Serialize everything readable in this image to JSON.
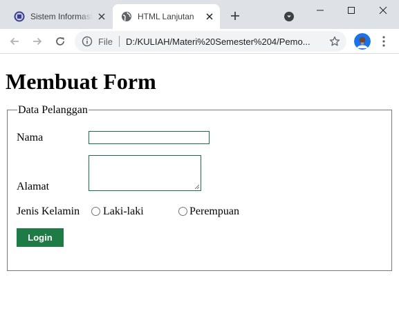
{
  "browser": {
    "tabs": [
      {
        "title": "Sistem Informasi"
      },
      {
        "title": "HTML Lanjutan"
      }
    ],
    "omnibox": {
      "scheme": "File",
      "url": "D:/KULIAH/Materi%20Semester%204/Pemo..."
    }
  },
  "page": {
    "heading": "Membuat Form",
    "form": {
      "legend": "Data Pelanggan",
      "name_label": "Nama",
      "name_value": "",
      "address_label": "Alamat",
      "address_value": "",
      "gender_label": "Jenis Kelamin",
      "gender_options": [
        "Laki-laki",
        "Perempuan"
      ],
      "submit_label": "Login"
    }
  },
  "colors": {
    "tabstrip": "#dee1e6",
    "button": "#1e7b45",
    "input_border": "#1d6b4a"
  },
  "icons": [
    "university-logo-icon",
    "globe-icon",
    "close-icon",
    "plus-icon",
    "tab-search-icon",
    "minimize-icon",
    "maximize-icon",
    "window-close-icon",
    "back-arrow-icon",
    "forward-arrow-icon",
    "reload-icon",
    "info-icon",
    "star-icon",
    "profile-avatar",
    "kebab-menu-icon"
  ]
}
